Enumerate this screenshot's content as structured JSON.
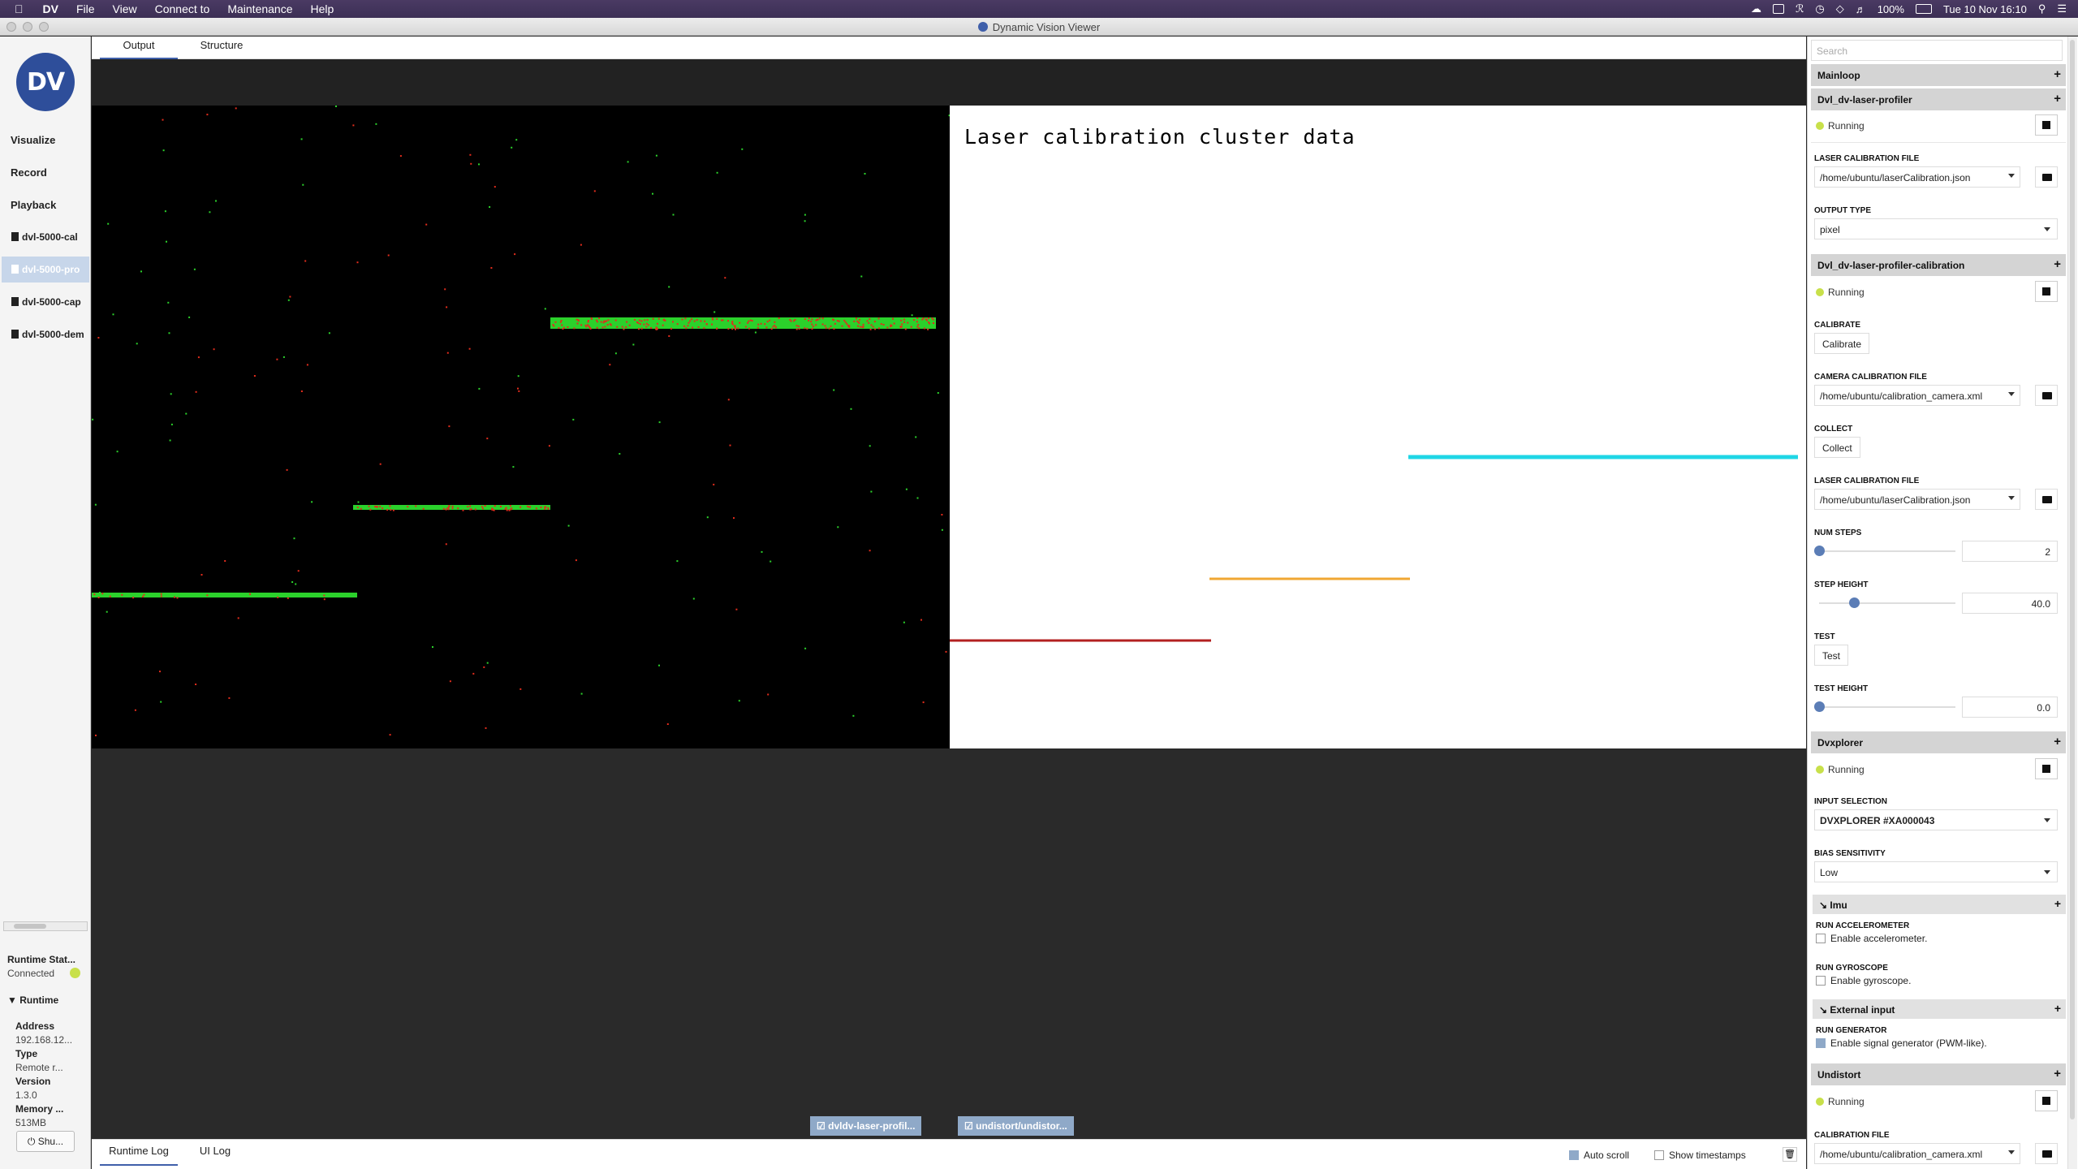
{
  "menubar": {
    "app_name": "DV",
    "menus": [
      "File",
      "View",
      "Connect to",
      "Maintenance",
      "Help"
    ],
    "battery": "100%",
    "clock": "Tue 10 Nov  16:10"
  },
  "window": {
    "title": "Dynamic Vision Viewer"
  },
  "sidebar": {
    "logo_text": "DV",
    "nav": [
      "Visualize",
      "Record",
      "Playback"
    ],
    "files": [
      "dvl-5000-cal",
      "dvl-5000-pro",
      "dvl-5000-cap",
      "dvl-5000-dem"
    ],
    "runtime_status_title": "Runtime Stat...",
    "runtime_status_value": "Connected",
    "runtime_header": "Runtime",
    "address_label": "Address",
    "address_value": "192.168.12...",
    "type_label": "Type",
    "type_value": "Remote r...",
    "version_label": "Version",
    "version_value": "1.3.0",
    "memory_label": "Memory ...",
    "memory_value": "513MB",
    "shutdown_label": "Shu..."
  },
  "tabs": [
    "Output",
    "Structure"
  ],
  "view": {
    "calibration_title": "Laser calibration cluster data",
    "stream_tabs": [
      "dvldv-laser-profil...",
      "undistort/undistor..."
    ]
  },
  "logbar": {
    "tabs": [
      "Runtime Log",
      "UI Log"
    ],
    "auto_scroll": "Auto scroll",
    "show_timestamps": "Show timestamps"
  },
  "panel": {
    "search_placeholder": "Search",
    "mainloop": "Mainloop",
    "profiler": {
      "title": "Dvl_dv-laser-profiler",
      "status": "Running",
      "laser_file_label": "LASER CALIBRATION FILE",
      "laser_file_value": "/home/ubuntu/laserCalibration.json",
      "output_type_label": "OUTPUT TYPE",
      "output_type_value": "pixel"
    },
    "calibration": {
      "title": "Dvl_dv-laser-profiler-calibration",
      "status": "Running",
      "calibrate_label": "CALIBRATE",
      "calibrate_button": "Calibrate",
      "camera_file_label": "CAMERA CALIBRATION FILE",
      "camera_file_value": "/home/ubuntu/calibration_camera.xml",
      "collect_label": "COLLECT",
      "collect_button": "Collect",
      "laser_file_label": "LASER CALIBRATION FILE",
      "laser_file_value": "/home/ubuntu/laserCalibration.json",
      "num_steps_label": "NUM STEPS",
      "num_steps_value": "2",
      "num_steps_fraction": 0.0,
      "step_height_label": "STEP HEIGHT",
      "step_height_value": "40.0",
      "step_height_fraction": 0.27,
      "test_label": "TEST",
      "test_button": "Test",
      "test_height_label": "TEST HEIGHT",
      "test_height_value": "0.0",
      "test_height_fraction": 0.0
    },
    "dvxplorer": {
      "title": "Dvxplorer",
      "status": "Running",
      "input_label": "INPUT SELECTION",
      "input_value": "DVXPLORER #XA000043",
      "bias_label": "BIAS SENSITIVITY",
      "bias_value": "Low",
      "imu_title": "Imu",
      "run_acc_label": "RUN ACCELEROMETER",
      "run_acc_text": "Enable accelerometer.",
      "run_gyro_label": "RUN GYROSCOPE",
      "run_gyro_text": "Enable gyroscope.",
      "ext_title": "External input",
      "run_gen_label": "RUN GENERATOR",
      "run_gen_text": "Enable signal generator (PWM-like)."
    },
    "undistort": {
      "title": "Undistort",
      "status": "Running",
      "calib_file_label": "CALIBRATION FILE",
      "calib_file_value": "/home/ubuntu/calibration_camera.xml"
    }
  },
  "colors": {
    "accent": "#3f5faa",
    "running_led": "#c8e04a",
    "events_on": "#2bd12b",
    "events_off": "#e22c1c",
    "cluster_cyan": "#1fd6e6",
    "cluster_orange": "#f0a733",
    "cluster_red": "#b32020"
  }
}
